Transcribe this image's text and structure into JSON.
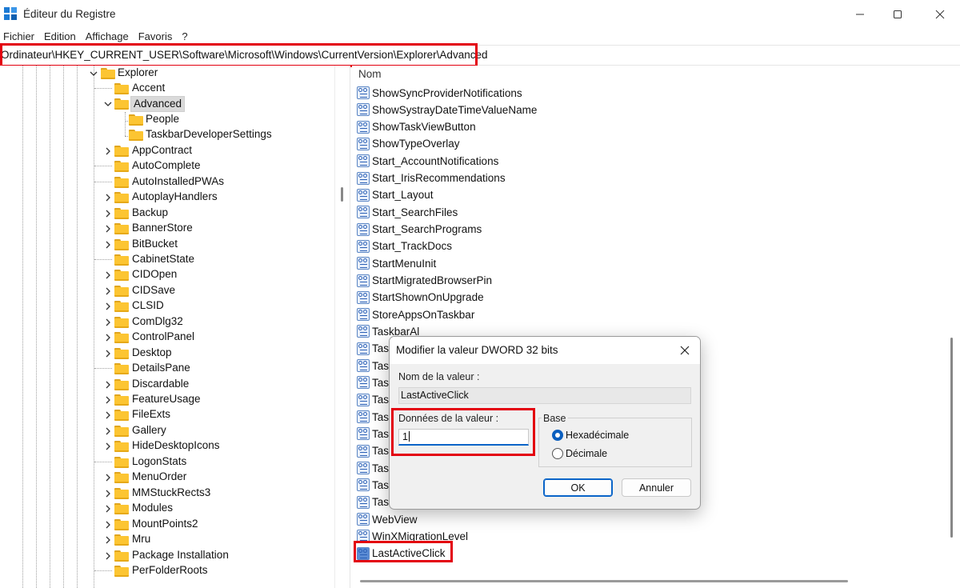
{
  "window": {
    "title": "Éditeur du Registre",
    "controls": [
      "minimize",
      "maximize",
      "close"
    ]
  },
  "menu": [
    "Fichier",
    "Edition",
    "Affichage",
    "Favoris",
    "?"
  ],
  "address": "Ordinateur\\HKEY_CURRENT_USER\\Software\\Microsoft\\Windows\\CurrentVersion\\Explorer\\Advanced",
  "tree": {
    "explorer": "Explorer",
    "items": [
      {
        "label": "Accent"
      },
      {
        "label": "Advanced"
      },
      {
        "label": "People"
      },
      {
        "label": "TaskbarDeveloperSettings"
      },
      {
        "label": "AppContract"
      },
      {
        "label": "AutoComplete"
      },
      {
        "label": "AutoInstalledPWAs"
      },
      {
        "label": "AutoplayHandlers"
      },
      {
        "label": "Backup"
      },
      {
        "label": "BannerStore"
      },
      {
        "label": "BitBucket"
      },
      {
        "label": "CabinetState"
      },
      {
        "label": "CIDOpen"
      },
      {
        "label": "CIDSave"
      },
      {
        "label": "CLSID"
      },
      {
        "label": "ComDlg32"
      },
      {
        "label": "ControlPanel"
      },
      {
        "label": "Desktop"
      },
      {
        "label": "DetailsPane"
      },
      {
        "label": "Discardable"
      },
      {
        "label": "FeatureUsage"
      },
      {
        "label": "FileExts"
      },
      {
        "label": "Gallery"
      },
      {
        "label": "HideDesktopIcons"
      },
      {
        "label": "LogonStats"
      },
      {
        "label": "MenuOrder"
      },
      {
        "label": "MMStuckRects3"
      },
      {
        "label": "Modules"
      },
      {
        "label": "MountPoints2"
      },
      {
        "label": "Mru"
      },
      {
        "label": "Package Installation"
      },
      {
        "label": "PerFolderRoots"
      }
    ]
  },
  "values": {
    "column_name": "Nom",
    "rows": [
      "ShowSyncProviderNotifications",
      "ShowSystrayDateTimeValueName",
      "ShowTaskViewButton",
      "ShowTypeOverlay",
      "Start_AccountNotifications",
      "Start_IrisRecommendations",
      "Start_Layout",
      "Start_SearchFiles",
      "Start_SearchPrograms",
      "Start_TrackDocs",
      "StartMenuInit",
      "StartMigratedBrowserPin",
      "StartShownOnUpgrade",
      "StoreAppsOnTaskbar",
      "TaskbarAl",
      "Task",
      "Task",
      "Task",
      "Task",
      "Task",
      "Task",
      "Task",
      "Task",
      "Task",
      "Task",
      "WebView",
      "WinXMigrationLevel",
      "LastActiveClick"
    ]
  },
  "dialog": {
    "title": "Modifier la valeur DWORD 32 bits",
    "value_name_label": "Nom de la valeur :",
    "value_name": "LastActiveClick",
    "value_data_label": "Données de la valeur :",
    "value_data": "1",
    "base_label": "Base",
    "base_options": [
      "Hexadécimale",
      "Décimale"
    ],
    "base_selected": "Hexadécimale",
    "ok": "OK",
    "cancel": "Annuler"
  },
  "colors": {
    "highlight": "#e3000f",
    "accent": "#0a64c8",
    "folder": "#fcc532"
  }
}
